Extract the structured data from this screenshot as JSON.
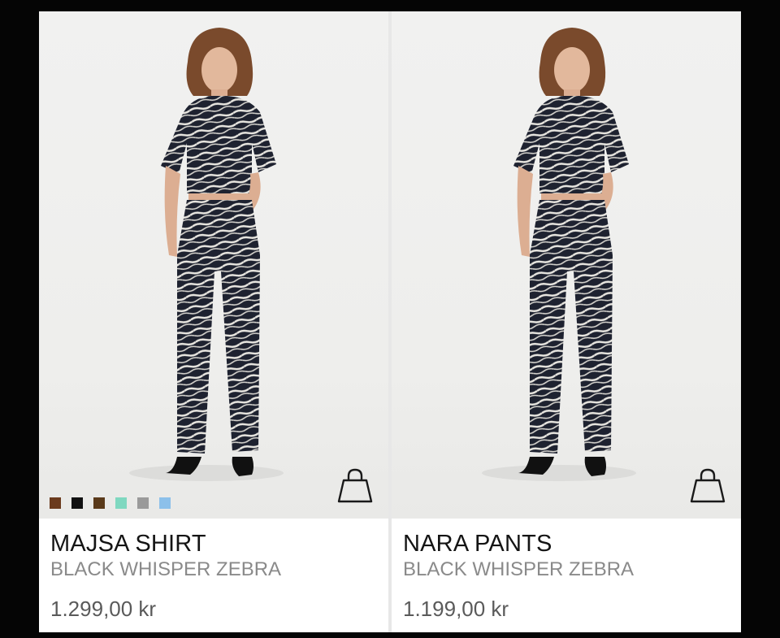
{
  "products": [
    {
      "name": "MAJSA SHIRT",
      "color_name": "BLACK WHISPER ZEBRA",
      "price": "1.299,00 kr",
      "add_to_bag_icon": "shopping-bag-icon",
      "swatches": [
        "#6b3b1e",
        "#111111",
        "#5a3a1a",
        "#7fd8c0",
        "#9a9a9a",
        "#8cc0ea"
      ]
    },
    {
      "name": "NARA PANTS",
      "color_name": "BLACK WHISPER ZEBRA",
      "price": "1.199,00 kr",
      "add_to_bag_icon": "shopping-bag-icon"
    }
  ]
}
